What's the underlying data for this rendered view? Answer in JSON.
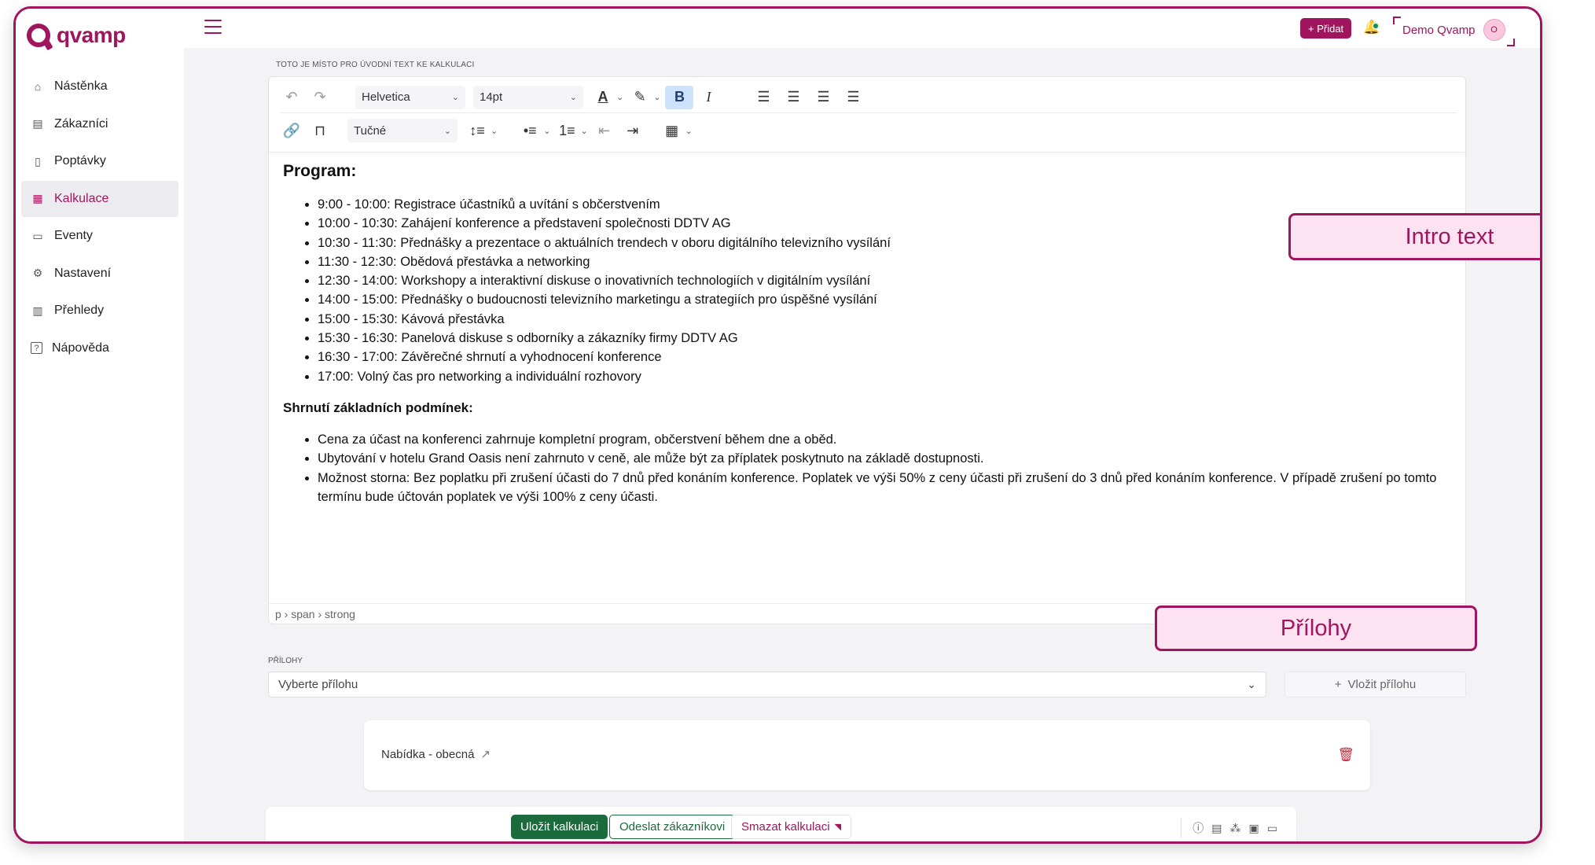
{
  "brand": {
    "name": "qvamp"
  },
  "sidebar": {
    "items": [
      {
        "label": "Nástěnka",
        "icon": "⌂",
        "icon_name": "home-icon",
        "active": false
      },
      {
        "label": "Zákazníci",
        "icon": "▤",
        "icon_name": "customers-icon",
        "active": false
      },
      {
        "label": "Poptávky",
        "icon": "▯",
        "icon_name": "requests-icon",
        "active": false
      },
      {
        "label": "Kalkulace",
        "icon": "▦",
        "icon_name": "calculation-icon",
        "active": true
      },
      {
        "label": "Eventy",
        "icon": "▭",
        "icon_name": "events-icon",
        "active": false
      },
      {
        "label": "Nastavení",
        "icon": "⚙",
        "icon_name": "settings-icon",
        "active": false
      },
      {
        "label": "Přehledy",
        "icon": "▥",
        "icon_name": "reports-icon",
        "active": false
      },
      {
        "label": "Nápověda",
        "icon": "?",
        "icon_name": "help-icon",
        "active": false
      }
    ]
  },
  "topbar": {
    "add_label": "+ Přidat",
    "user_name": "Demo Qvamp",
    "avatar_initial": "O"
  },
  "intro": {
    "label": "TOTO JE MÍSTO PRO ÚVODNÍ TEXT KE KALKULACI"
  },
  "toolbar": {
    "font_family": "Helvetica",
    "font_size": "14pt",
    "block_format": "Tučné"
  },
  "content": {
    "heading1": "Program:",
    "program": [
      "9:00 - 10:00: Registrace účastníků a uvítání s občerstvením",
      "10:00 - 10:30: Zahájení konference a představení společnosti DDTV AG",
      "10:30 - 11:30: Přednášky a prezentace o aktuálních trendech v oboru digitálního televizního vysílání",
      "11:30 - 12:30: Obědová přestávka a networking",
      "12:30 - 14:00: Workshopy a interaktivní diskuse o inovativních technologiích v digitálním vysílání",
      "14:00 - 15:00: Přednášky o budoucnosti televizního marketingu a strategiích pro úspěšné vysílání",
      "15:00 - 15:30: Kávová přestávka",
      "15:30 - 16:30: Panelová diskuse s odborníky a zákazníky firmy DDTV AG",
      "16:30 - 17:00: Závěrečné shrnutí a vyhodnocení konference",
      "17:00: Volný čas pro networking a individuální rozhovory"
    ],
    "heading2": "Shrnutí základních podmínek:",
    "conditions": [
      "Cena za účast na konferenci zahrnuje kompletní program, občerstvení během dne a oběd.",
      "Ubytování v hotelu Grand Oasis není zahrnuto v ceně, ale může být za příplatek poskytnuto na základě dostupnosti.",
      "Možnost storna: Bez poplatku při zrušení účasti do 7 dnů před konáním konference. Poplatek ve výši 50% z ceny účasti při zrušení do 3 dnů před konáním konference. V případě zrušení po tomto termínu bude účtován poplatek ve výši 100% z ceny účasti."
    ],
    "path": "p › span › strong"
  },
  "callouts": {
    "intro": "Intro text",
    "attachments": "Přílohy"
  },
  "attachments": {
    "label": "PŘÍLOHY",
    "select_placeholder": "Vyberte přílohu",
    "insert_label": "Vložit přílohu",
    "items": [
      {
        "name": "Nabídka - obecná"
      }
    ]
  },
  "actions": {
    "save": "Uložit kalkulaci",
    "send": "Odeslat zákazníkovi",
    "delete": "Smazat kalkulaci"
  },
  "colors": {
    "accent": "#a0155e",
    "primary_green": "#1b6b3d",
    "danger": "#c22a3a"
  }
}
